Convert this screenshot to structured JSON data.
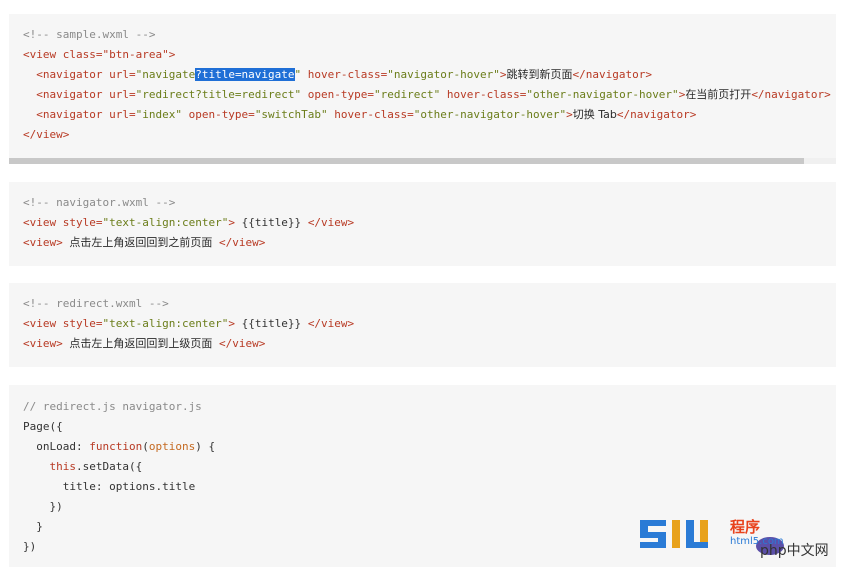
{
  "blocks": [
    {
      "lines": [
        "<!-- sample.wxml -->",
        "<view class=\"btn-area\">",
        "  <navigator url=\"navigate?title=navigate\" hover-class=\"navigator-hover\">跳转到新页面</navigator>",
        "  <navigator url=\"redirect?title=redirect\" open-type=\"redirect\" hover-class=\"other-navigator-hover\">在当前页打开</navigator>",
        "  <navigator url=\"index\" open-type=\"switchTab\" hover-class=\"other-navigator-hover\">切换 Tab</navigator>",
        "</view>"
      ],
      "selected_text": "?title=navigate"
    },
    {
      "lines": [
        "<!-- navigator.wxml -->",
        "<view style=\"text-align:center\"> {{title}} </view>",
        "<view> 点击左上角返回回到之前页面 </view>"
      ]
    },
    {
      "lines": [
        "<!-- redirect.wxml -->",
        "<view style=\"text-align:center\"> {{title}} </view>",
        "<view> 点击左上角返回回到上级页面 </view>"
      ]
    },
    {
      "lines": [
        "// redirect.js navigator.js",
        "Page({",
        "  onLoad: function(options) {",
        "    this.setData({",
        "      title: options.title",
        "    })",
        "  }",
        "})"
      ]
    }
  ],
  "watermark": {
    "brand": "php中文网",
    "site": "html5.com",
    "cn": "程序"
  },
  "colors": {
    "block_bg": "#f6f6f6",
    "tag": "#b83a24",
    "string": "#6b7d1a",
    "comment": "#8a8a8a",
    "selection": "#1f6fd6"
  }
}
